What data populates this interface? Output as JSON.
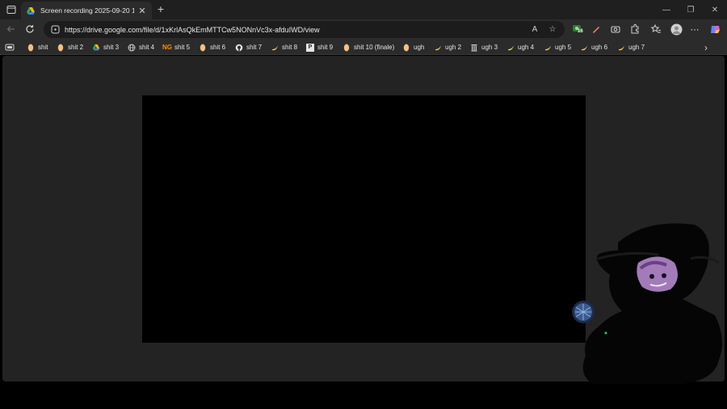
{
  "tab": {
    "title": "Screen recording 2025-09-20 12:",
    "close_glyph": "✕"
  },
  "newtab_glyph": "+",
  "window_controls": {
    "minimize": "—",
    "restore": "❐",
    "close": "✕"
  },
  "address_bar": {
    "url": "https://drive.google.com/file/d/1xKrlAsQkEmMTTCw5NONnVc3x-afduIWD/view"
  },
  "toolbar": {
    "extension_badge": "16",
    "menu_glyph": "⋯"
  },
  "bookmarks": [
    {
      "label": "shit",
      "icon": "pasta-icon"
    },
    {
      "label": "shit 2",
      "icon": "pasta-icon"
    },
    {
      "label": "shit 3",
      "icon": "drive-icon"
    },
    {
      "label": "shit 4",
      "icon": "globe-icon"
    },
    {
      "label": "shit 5",
      "icon": "ng-icon",
      "icon_text": "NG"
    },
    {
      "label": "shit 6",
      "icon": "pasta-icon"
    },
    {
      "label": "shit 7",
      "icon": "github-icon"
    },
    {
      "label": "shit 8",
      "icon": "banana-icon"
    },
    {
      "label": "shit 9",
      "icon": "p-icon",
      "icon_text": "P"
    },
    {
      "label": "shit 10 (finale)",
      "icon": "pasta-icon"
    },
    {
      "label": "ugh",
      "icon": "pasta-icon"
    },
    {
      "label": "ugh 2",
      "icon": "banana-icon"
    },
    {
      "label": "ugh 3",
      "icon": "archive-icon"
    },
    {
      "label": "ugh 4",
      "icon": "banana-icon"
    },
    {
      "label": "ugh 5",
      "icon": "banana-icon"
    },
    {
      "label": "ugh 6",
      "icon": "banana-icon"
    },
    {
      "label": "ugh 7",
      "icon": "banana-icon"
    }
  ],
  "bookmarks_overflow_glyph": "›",
  "colors": {
    "viewer_bg": "#232323",
    "video_bg": "#000000",
    "toolbar_bg": "#2b2b2b",
    "titlebar_bg": "#1f1f1f"
  }
}
